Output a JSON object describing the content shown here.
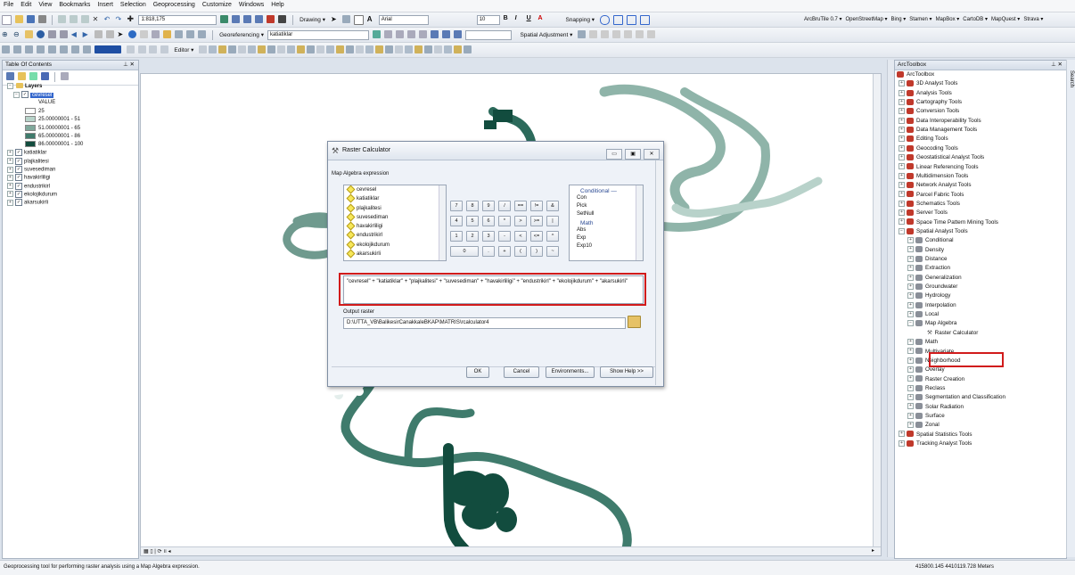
{
  "menu": [
    "File",
    "Edit",
    "View",
    "Bookmarks",
    "Insert",
    "Selection",
    "Geoprocessing",
    "Customize",
    "Windows",
    "Help"
  ],
  "toolbar": {
    "scale": "1:818,175",
    "drawing_label": "Drawing ▾",
    "font_name": "Arial",
    "font_size": "10",
    "snapping_label": "Snapping ▾",
    "basemaps": [
      "ArcBruTile 0.7 ▾",
      "OpenStreetMap ▾",
      "Bing ▾",
      "Stamen ▾",
      "MapBox ▾",
      "CartoDB ▾",
      "MapQuest ▾",
      "Strava ▾"
    ],
    "georef_label": "Georeferencing ▾",
    "georef_layer": "katiatiklar",
    "spatial_adj_label": "Spatial Adjustment ▾",
    "editor_label": "Editor ▾"
  },
  "toc": {
    "title": "Table Of Contents",
    "root": "Layers",
    "active_layer": "cevresel",
    "value_label": "VALUE",
    "legend": [
      {
        "label": "25",
        "color": "#ffffff"
      },
      {
        "label": "25.00000001 - 51",
        "color": "#b7d3c9"
      },
      {
        "label": "51.00000001 - 65",
        "color": "#7fa89b"
      },
      {
        "label": "65.00000001 - 86",
        "color": "#3f7b6c"
      },
      {
        "label": "86.00000001 - 100",
        "color": "#124c3e"
      }
    ],
    "layers": [
      "katiatiklar",
      "plajkalitesi",
      "suvesediman",
      "havakirliligi",
      "endustrikirl",
      "ekolojikdurum",
      "akarsukirli"
    ]
  },
  "dialog": {
    "title": "Raster Calculator",
    "expression_label": "Map Algebra expression",
    "raster_list": [
      "cevresel",
      "katiatiklar",
      "plajkalitesi",
      "suvesediman",
      "havakirliligi",
      "endustrikirl",
      "ekolojikdurum",
      "akarsukirli"
    ],
    "keypad": [
      [
        "7",
        "8",
        "9",
        "/",
        "==",
        "!=",
        "&"
      ],
      [
        "4",
        "5",
        "6",
        "*",
        ">",
        ">=",
        "|"
      ],
      [
        "1",
        "2",
        "3",
        "-",
        "<",
        "<=",
        "^"
      ],
      [
        "0",
        ".",
        "+",
        "(",
        ")",
        "~"
      ]
    ],
    "functions_header": "Conditional —",
    "functions": [
      "Con",
      "Pick",
      "SetNull"
    ],
    "math_header": "Math",
    "math_functions": [
      "Abs",
      "Exp",
      "Exp10"
    ],
    "expression": "\"cevresel\" + \"katiatiklar\" + \"plajkalitesi\" + \"suvesediman\" + \"havakirliligi\" + \"endustrikirl\" + \"ekolojikdurum\" + \"akarsukirli\"",
    "output_label": "Output raster",
    "output_path": "D:\\UTTA_VB\\BalikesirCanakkaleBKAP\\MATRIS\\rcalculator4",
    "buttons": {
      "ok": "OK",
      "cancel": "Cancel",
      "environments": "Environments...",
      "help": "Show Help >>"
    }
  },
  "toolbox": {
    "title": "ArcToolbox",
    "root": "ArcToolbox",
    "top_items": [
      "3D Analyst Tools",
      "Analysis Tools",
      "Cartography Tools",
      "Conversion Tools",
      "Data Interoperability Tools",
      "Data Management Tools",
      "Editing Tools",
      "Geocoding Tools",
      "Geostatistical Analyst Tools",
      "Linear Referencing Tools",
      "Multidimension Tools",
      "Network Analyst Tools",
      "Parcel Fabric Tools",
      "Schematics Tools",
      "Server Tools",
      "Space Time Pattern Mining Tools",
      "Spatial Analyst Tools"
    ],
    "spatial_children_before": [
      "Conditional",
      "Density",
      "Distance",
      "Extraction",
      "Generalization",
      "Groundwater",
      "Hydrology",
      "Interpolation",
      "Local",
      "Map Algebra"
    ],
    "raster_calculator": "Raster Calculator",
    "spatial_children_after": [
      "Math",
      "Multivariate",
      "Neighborhood",
      "Overlay",
      "Raster Creation",
      "Reclass",
      "Segmentation and Classification",
      "Solar Radiation",
      "Surface",
      "Zonal"
    ],
    "bottom_items": [
      "Spatial Statistics Tools",
      "Tracking Analyst Tools"
    ],
    "search_tab": "Search"
  },
  "status": {
    "message": "Geoprocessing tool for performing raster analysis using a Map Algebra expression.",
    "coords": "415800.145  4410119.728 Meters"
  },
  "colors": {
    "accent_red": "#d11b1b",
    "dark_raster": "#124c3e",
    "mid_raster": "#3f7b6c",
    "light_raster": "#8fb4a9"
  }
}
